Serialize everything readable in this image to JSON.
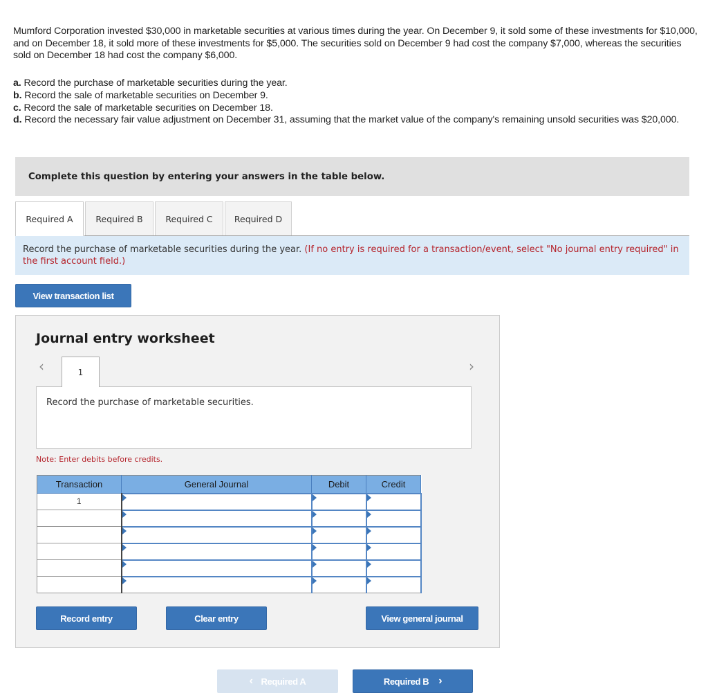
{
  "problem": {
    "text": "Mumford Corporation invested $30,000 in marketable securities at various times during the year. On December 9, it sold some of these investments for $10,000, and on December 18, it sold more of these investments for $5,000. The securities sold on December 9 had cost the company $7,000, whereas the securities sold on December 18 had cost the company $6,000.",
    "parts": [
      {
        "label": "a.",
        "text": " Record the purchase of marketable securities during the year."
      },
      {
        "label": "b.",
        "text": " Record the sale of marketable securities on December 9."
      },
      {
        "label": "c.",
        "text": " Record the sale of marketable securities on December 18."
      },
      {
        "label": "d.",
        "text": " Record the necessary fair value adjustment on December 31, assuming that the market value of the company's remaining unsold securities was $20,000."
      }
    ]
  },
  "complete_bar": "Complete this question by entering your answers in the table below.",
  "tabs": [
    {
      "label": "Required A",
      "active": true
    },
    {
      "label": "Required B",
      "active": false
    },
    {
      "label": "Required C",
      "active": false
    },
    {
      "label": "Required D",
      "active": false
    }
  ],
  "instruction": {
    "main": "Record the purchase of marketable securities during the year. ",
    "note": "(If no entry is required for a transaction/event, select \"No journal entry required\" in the first account field.)"
  },
  "view_transaction_list": "View transaction list",
  "worksheet": {
    "title": "Journal entry worksheet",
    "prev_icon": "‹",
    "next_icon": "›",
    "current_tab": "1",
    "description": "Record the purchase of marketable securities.",
    "note": "Note: Enter debits before credits.",
    "columns": [
      "Transaction",
      "General Journal",
      "Debit",
      "Credit"
    ],
    "rows": [
      {
        "transaction": "1",
        "account": "",
        "debit": "",
        "credit": ""
      },
      {
        "transaction": "",
        "account": "",
        "debit": "",
        "credit": ""
      },
      {
        "transaction": "",
        "account": "",
        "debit": "",
        "credit": ""
      },
      {
        "transaction": "",
        "account": "",
        "debit": "",
        "credit": ""
      },
      {
        "transaction": "",
        "account": "",
        "debit": "",
        "credit": ""
      },
      {
        "transaction": "",
        "account": "",
        "debit": "",
        "credit": ""
      }
    ],
    "buttons": {
      "record": "Record entry",
      "clear": "Clear entry",
      "view_journal": "View general journal"
    }
  },
  "nav": {
    "prev_label": "Required A",
    "prev_icon": "‹",
    "next_label": "Required B",
    "next_icon": "›"
  },
  "colors": {
    "button_blue": "#3b76b9",
    "header_blue": "#7aaee3",
    "instruction_bg": "#dbeaf7",
    "alert_red": "#b5242c"
  }
}
